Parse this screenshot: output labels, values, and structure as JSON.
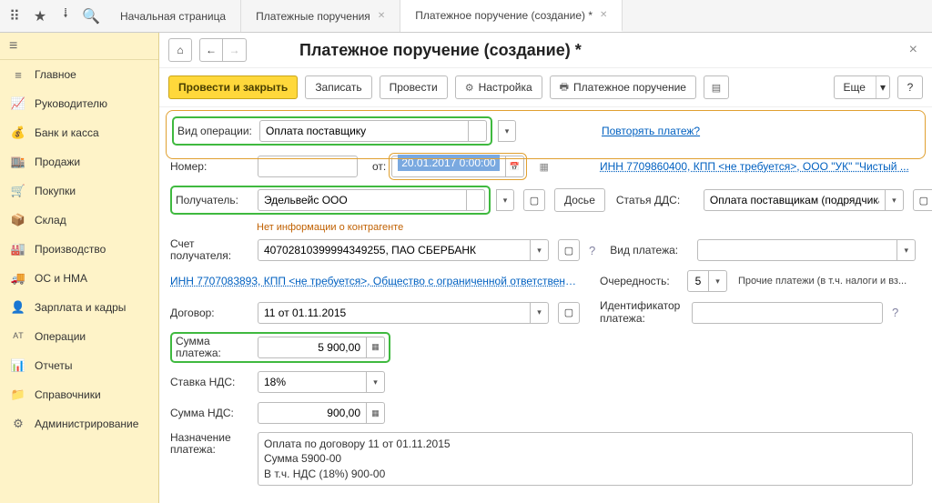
{
  "tabs": {
    "start": "Начальная страница",
    "orders": "Платежные поручения",
    "active": "Платежное поручение (создание) *"
  },
  "sidebar": {
    "items": [
      {
        "icon": "≡",
        "label": "Главное"
      },
      {
        "icon": "📈",
        "label": "Руководителю"
      },
      {
        "icon": "💰",
        "label": "Банк и касса"
      },
      {
        "icon": "🏬",
        "label": "Продажи"
      },
      {
        "icon": "🛒",
        "label": "Покупки"
      },
      {
        "icon": "📦",
        "label": "Склад"
      },
      {
        "icon": "🏭",
        "label": "Производство"
      },
      {
        "icon": "🚚",
        "label": "ОС и НМА"
      },
      {
        "icon": "👤",
        "label": "Зарплата и кадры"
      },
      {
        "icon": "ᴬᵀ",
        "label": "Операции"
      },
      {
        "icon": "📊",
        "label": "Отчеты"
      },
      {
        "icon": "📁",
        "label": "Справочники"
      },
      {
        "icon": "⚙",
        "label": "Администрирование"
      }
    ]
  },
  "header": {
    "title": "Платежное поручение (создание) *"
  },
  "toolbar": {
    "post_close": "Провести и закрыть",
    "save": "Записать",
    "post": "Провести",
    "settings": "Настройка",
    "print": "Платежное поручение",
    "more": "Еще"
  },
  "form": {
    "op_type_label": "Вид операции:",
    "op_type": "Оплата поставщику",
    "repeat_link": "Повторять платеж?",
    "number_label": "Номер:",
    "number": "",
    "from_label": "от:",
    "date": "20.01.2017  0:00:00",
    "inn_link1": "ИНН 7709860400, КПП <не требуется>, ООО \"УК\" \"Чистый ...",
    "recipient_label": "Получатель:",
    "recipient": "Эдельвейс ООО",
    "dossier_btn": "Досье",
    "dds_label": "Статья ДДС:",
    "dds_value": "Оплата поставщикам (подрядчикам)",
    "no_info": "Нет информации о контрагенте",
    "acct_label": "Счет получателя:",
    "acct_value": "40702810399994349255, ПАО СБЕРБАНК",
    "pay_type_label": "Вид платежа:",
    "pay_type": "",
    "inn_link2": "ИНН 7707083893, КПП <не требуется>, Общество с ограниченной ответственность...",
    "priority_label": "Очередность:",
    "priority": "5",
    "priority_note": "Прочие платежи (в т.ч. налоги и вз...",
    "contract_label": "Договор:",
    "contract": "11 от 01.11.2015",
    "id_label": "Идентификатор платежа:",
    "id_value": "",
    "sum_label": "Сумма платежа:",
    "sum": "5 900,00",
    "vat_rate_label": "Ставка НДС:",
    "vat_rate": "18%",
    "vat_sum_label": "Сумма НДС:",
    "vat_sum": "900,00",
    "purpose_label": "Назначение платежа:",
    "purpose_l1": "Оплата по договору 11 от 01.11.2015",
    "purpose_l2": "Сумма 5900-00",
    "purpose_l3": "В т.ч. НДС  (18%) 900-00"
  }
}
